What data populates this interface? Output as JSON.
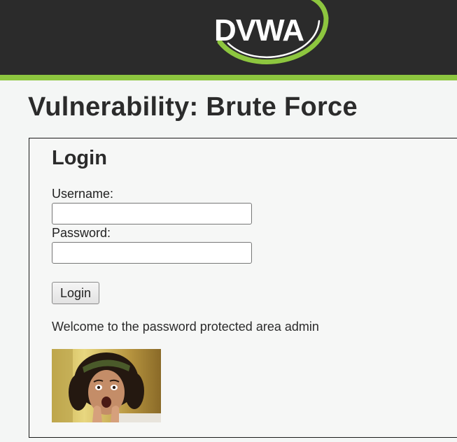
{
  "header": {
    "logo_text": "DVWA",
    "bg_color": "#2b2b2b",
    "accent_color": "#8dc63f"
  },
  "page": {
    "title": "Vulnerability: Brute Force"
  },
  "login_form": {
    "heading": "Login",
    "username_label": "Username:",
    "username_value": "",
    "password_label": "Password:",
    "password_value": "",
    "submit_label": "Login"
  },
  "result": {
    "welcome_message": "Welcome to the password protected area admin",
    "photo": "surprised-user-photo"
  }
}
